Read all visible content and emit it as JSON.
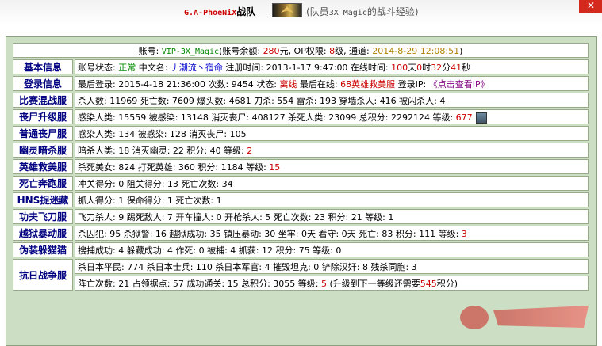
{
  "header": {
    "clan_name": "G.A-PhoeNiX",
    "clan_suffix": "战队",
    "member_prefix": "(队员",
    "member_id": "3X_Magic",
    "member_suffix": "的战斗经验)"
  },
  "account": {
    "label_account": "账号: ",
    "account_id": "VIP-3X_Magic",
    "balance_label": "(账号余额: ",
    "balance": "280",
    "balance_unit": "元",
    "op_label": ", OP权限: ",
    "op_level": "8",
    "op_unit": "级",
    "channel_label": ", 通道: ",
    "channel_time": "2014-8-29 12:08:51",
    "close": ")"
  },
  "rows": [
    {
      "label": "基本信息",
      "parts": [
        {
          "t": "账号状态: "
        },
        {
          "t": "正常",
          "c": "g"
        },
        {
          "t": " 中文名: "
        },
        {
          "t": "丿潮流丶宿命",
          "c": "v"
        },
        {
          "t": " 注册时间: 2013-1-17 9:47:00 在线时间: "
        },
        {
          "t": "100",
          "c": "r"
        },
        {
          "t": "天"
        },
        {
          "t": "0",
          "c": "r"
        },
        {
          "t": "时"
        },
        {
          "t": "32",
          "c": "r"
        },
        {
          "t": "分"
        },
        {
          "t": "41",
          "c": "r"
        },
        {
          "t": "秒"
        }
      ]
    },
    {
      "label": "登录信息",
      "parts": [
        {
          "t": "最后登录: 2015-4-18 21:36:00 次数: 9454 状态: "
        },
        {
          "t": "离线",
          "c": "r"
        },
        {
          "t": " 最后在线: "
        },
        {
          "t": "68英雄救美服",
          "c": "r"
        },
        {
          "t": " 登录IP: "
        },
        {
          "t": "《点击查看IP》",
          "c": "m"
        }
      ]
    },
    {
      "label": "比赛混战服",
      "parts": [
        {
          "t": "杀人数: 11969 死亡数: 7609 爆头数: 4681 刀杀: 554 雷杀: 193 穿墙杀人: 416 被闪杀人: 4"
        }
      ]
    },
    {
      "label": "丧尸升级服",
      "parts": [
        {
          "t": "感染人类: 15559 被感染: 13148 消灭丧尸: 408127 杀死人类: 23099 总积分: 2292124 等级: "
        },
        {
          "t": "677",
          "c": "r"
        }
      ],
      "avatar": true
    },
    {
      "label": "普通丧尸服",
      "parts": [
        {
          "t": "感染人类: 134 被感染: 128 消灭丧尸: 105"
        }
      ]
    },
    {
      "label": "幽灵暗杀服",
      "parts": [
        {
          "t": "暗杀人类: 18 消灭幽灵: 22 积分: 40 等级: "
        },
        {
          "t": "2",
          "c": "r"
        }
      ]
    },
    {
      "label": "英雄救美服",
      "parts": [
        {
          "t": "杀死美女: 824 打死英雄: 360 积分: 1184 等级: "
        },
        {
          "t": "15",
          "c": "r"
        }
      ]
    },
    {
      "label": "死亡奔跑服",
      "parts": [
        {
          "t": "冲关得分: 0 阻关得分: 13 死亡次数: 34"
        }
      ]
    },
    {
      "label": "HNS捉迷藏",
      "parts": [
        {
          "t": "抓人得分: 1 保命得分: 1 死亡次数: 1"
        }
      ]
    },
    {
      "label": "功夫飞刀服",
      "parts": [
        {
          "t": "飞刀杀人: 9 踢死敌人: 7 开车撞人: 0 开枪杀人: 5 死亡次数: 23 积分: 21 等级: 1"
        }
      ]
    },
    {
      "label": "越狱暴动服",
      "parts": [
        {
          "t": "杀囚犯: 95 杀狱警: 16 越狱成功: 35 镇压暴动: 30 坐牢: 0天 看守: 0天 死亡: 83 积分: 111 等级: "
        },
        {
          "t": "3",
          "c": "r"
        }
      ]
    },
    {
      "label": "伪装躲猫猫",
      "parts": [
        {
          "t": "搜捕成功: 4 躲藏成功: 4 作死: 0 被捕: 4 抓获: 12 积分: 75 等级: 0"
        }
      ]
    }
  ],
  "war": {
    "label": "抗日战争服",
    "line1": "杀日本平民: 774 杀日本士兵: 110 杀日本军官: 4 摧毁坦克: 0 铲除汉奸: 8 残杀同胞: 3",
    "line2_a": "阵亡次数: 21 占领据点: 57 成功通关: 15 总积分: 3055 等级: ",
    "line2_level": "5",
    "line2_b": " (升级到下一等级还需要",
    "line2_need": "545",
    "line2_c": "积分)"
  }
}
